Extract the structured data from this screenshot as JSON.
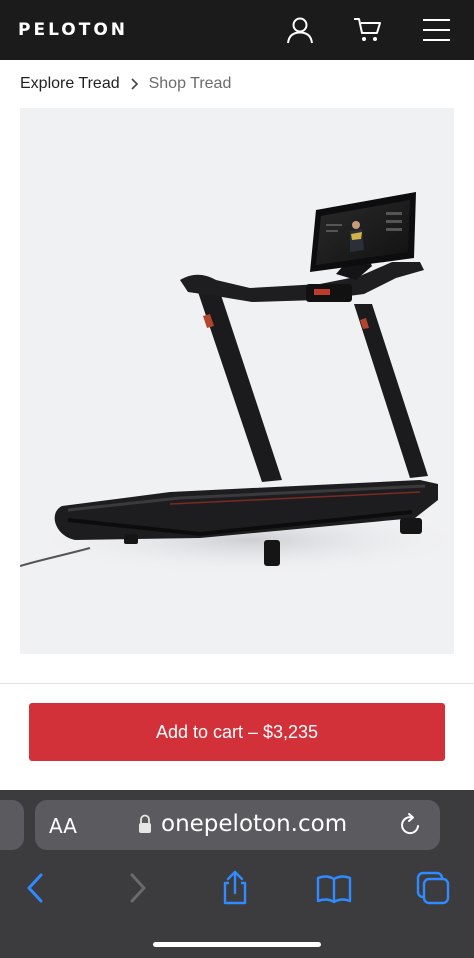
{
  "header": {
    "logo": "PELOTON",
    "icons": [
      "account-icon",
      "cart-icon",
      "menu-icon"
    ]
  },
  "breadcrumb": {
    "items": [
      "Explore Tread",
      "Shop Tread"
    ]
  },
  "product": {
    "image": "treadmill-image"
  },
  "cta": {
    "add_to_cart": "Add to cart – $3,235"
  },
  "browser": {
    "text_size": "AA",
    "url": "onepeloton.com",
    "toolbar": [
      "back-icon",
      "forward-icon",
      "share-icon",
      "bookmarks-icon",
      "tabs-icon"
    ]
  },
  "colors": {
    "header_bg": "#1b1b1b",
    "cta_red": "#d3313a",
    "safari_blue": "#2f8bff",
    "safari_bar": "#3c3c3e"
  }
}
